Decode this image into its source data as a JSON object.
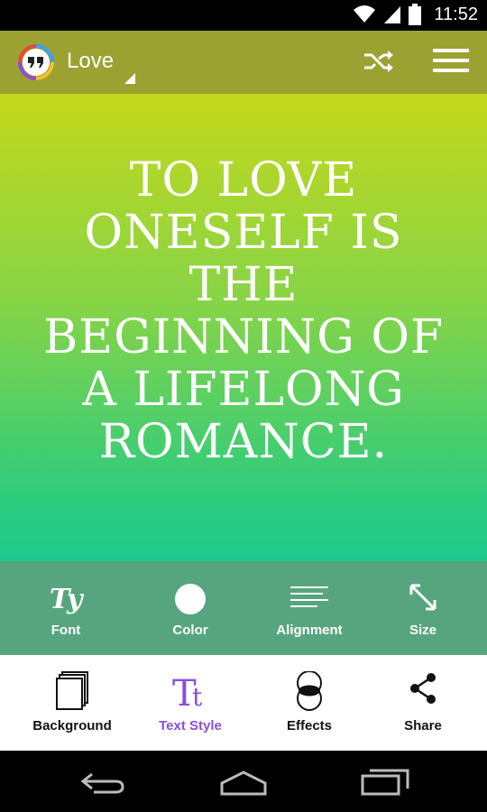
{
  "status_bar": {
    "time": "11:52",
    "icons": [
      "wifi-icon",
      "signal-icon",
      "battery-icon"
    ]
  },
  "app_bar": {
    "title": "Love",
    "actions": [
      "shuffle-icon",
      "menu-icon"
    ]
  },
  "quote": {
    "text": "To love oneself is the beginning of a lifelong romance."
  },
  "tools": [
    {
      "label": "Font",
      "icon": "font-icon"
    },
    {
      "label": "Color",
      "icon": "color-circle-icon"
    },
    {
      "label": "Alignment",
      "icon": "alignment-icon"
    },
    {
      "label": "Size",
      "icon": "resize-icon"
    }
  ],
  "tabs": [
    {
      "label": "Background",
      "icon": "layers-icon"
    },
    {
      "label": "Text Style",
      "icon": "text-style-icon",
      "active": true
    },
    {
      "label": "Effects",
      "icon": "effects-icon"
    },
    {
      "label": "Share",
      "icon": "share-icon"
    }
  ],
  "colors": {
    "app_bar": "#9ba232",
    "tools_bar": "#57a57e",
    "active_tab": "#8a4fd8",
    "gradient_top": "#c5d81b",
    "gradient_bottom": "#1ec98e"
  }
}
